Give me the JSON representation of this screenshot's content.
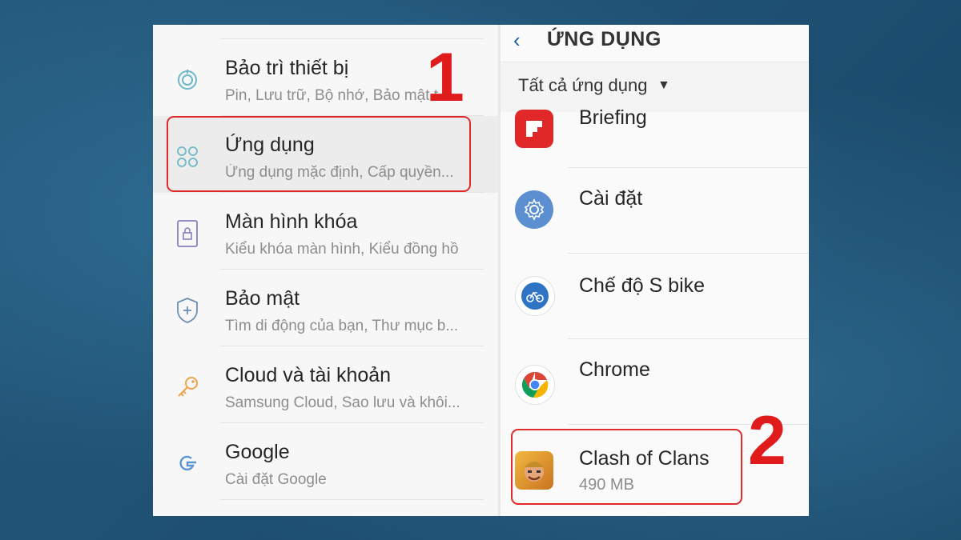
{
  "settings_list": {
    "items": [
      {
        "icon": "maintenance-icon",
        "title": "Bảo trì thiết bị",
        "subtitle": "Pin, Lưu trữ, Bộ nhớ, Bảo mật t..."
      },
      {
        "icon": "apps-grid-icon",
        "title": "Ứng dụng",
        "subtitle": "Ứng dụng mặc định, Cấp quyền..."
      },
      {
        "icon": "lock-screen-icon",
        "title": "Màn hình khóa",
        "subtitle": "Kiểu khóa màn hình, Kiểu đồng hồ"
      },
      {
        "icon": "shield-icon",
        "title": "Bảo mật",
        "subtitle": "Tìm di động của bạn, Thư mục b..."
      },
      {
        "icon": "key-icon",
        "title": "Cloud và tài khoản",
        "subtitle": "Samsung Cloud, Sao lưu và khôi..."
      },
      {
        "icon": "google-icon",
        "title": "Google",
        "subtitle": "Cài đặt Google"
      }
    ]
  },
  "apps_screen": {
    "title": "ỨNG DỤNG",
    "filter_label": "Tất cả ứng dụng",
    "apps": [
      {
        "icon": "flipboard-icon",
        "name": "Briefing",
        "size": ""
      },
      {
        "icon": "settings-gear-icon",
        "name": "Cài đặt",
        "size": ""
      },
      {
        "icon": "s-bike-icon",
        "name": "Chế độ S bike",
        "size": ""
      },
      {
        "icon": "chrome-icon",
        "name": "Chrome",
        "size": ""
      },
      {
        "icon": "clash-of-clans-icon",
        "name": "Clash of Clans",
        "size": "490 MB"
      }
    ]
  },
  "annotations": {
    "step1": "1",
    "step2": "2"
  },
  "colors": {
    "highlight_red": "#e02b2b",
    "icon_teal": "#6fb7c9",
    "accent_blue": "#1f5f9e"
  }
}
